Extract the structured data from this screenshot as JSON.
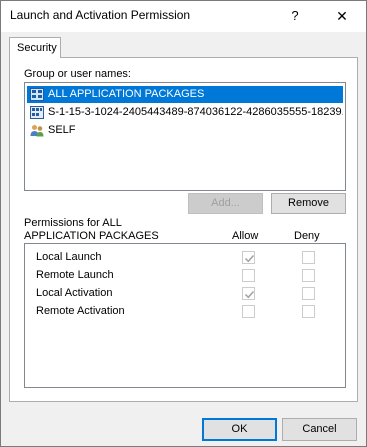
{
  "window": {
    "title": "Launch and Activation Permission",
    "help_glyph": "?",
    "close_glyph": "✕"
  },
  "tabs": [
    {
      "label": "Security"
    }
  ],
  "groups": {
    "label": "Group or user names:",
    "items": [
      {
        "name": "ALL APPLICATION PACKAGES",
        "icon": "app-packages-icon",
        "selected": true
      },
      {
        "name": "S-1-15-3-1024-2405443489-874036122-4286035555-18239...",
        "icon": "capability-icon",
        "selected": false
      },
      {
        "name": "SELF",
        "icon": "users-icon",
        "selected": false
      }
    ]
  },
  "group_buttons": {
    "add": "Add...",
    "remove": "Remove"
  },
  "permissions": {
    "label_line1": "Permissions for ALL",
    "label_line2": "APPLICATION PACKAGES",
    "allow_header": "Allow",
    "deny_header": "Deny",
    "rows": [
      {
        "name": "Local Launch",
        "allow": true,
        "deny": false
      },
      {
        "name": "Remote Launch",
        "allow": false,
        "deny": false
      },
      {
        "name": "Local Activation",
        "allow": true,
        "deny": false
      },
      {
        "name": "Remote Activation",
        "allow": false,
        "deny": false
      }
    ]
  },
  "footer": {
    "ok": "OK",
    "cancel": "Cancel"
  },
  "colors": {
    "selection": "#0078d7",
    "disabled_check": "#a0a0a0"
  }
}
